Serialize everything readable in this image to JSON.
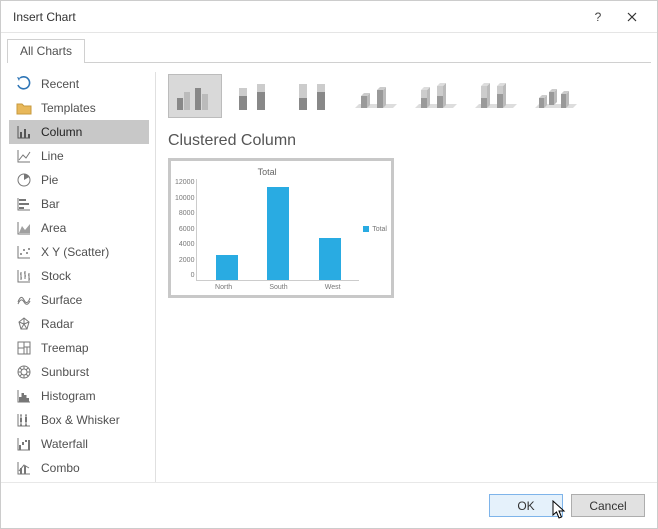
{
  "window": {
    "title": "Insert Chart",
    "help": "?",
    "close": "✕"
  },
  "tabs": {
    "all_charts": "All Charts"
  },
  "side_items": [
    {
      "icon": "recent-icon",
      "label": "Recent"
    },
    {
      "icon": "templates-icon",
      "label": "Templates"
    },
    {
      "icon": "column-icon",
      "label": "Column",
      "selected": true
    },
    {
      "icon": "line-icon",
      "label": "Line"
    },
    {
      "icon": "pie-icon",
      "label": "Pie"
    },
    {
      "icon": "bar-icon",
      "label": "Bar"
    },
    {
      "icon": "area-icon",
      "label": "Area"
    },
    {
      "icon": "xy-icon",
      "label": "X Y (Scatter)"
    },
    {
      "icon": "stock-icon",
      "label": "Stock"
    },
    {
      "icon": "surface-icon",
      "label": "Surface"
    },
    {
      "icon": "radar-icon",
      "label": "Radar"
    },
    {
      "icon": "treemap-icon",
      "label": "Treemap"
    },
    {
      "icon": "sunburst-icon",
      "label": "Sunburst"
    },
    {
      "icon": "histogram-icon",
      "label": "Histogram"
    },
    {
      "icon": "boxwhisker-icon",
      "label": "Box & Whisker"
    },
    {
      "icon": "waterfall-icon",
      "label": "Waterfall"
    },
    {
      "icon": "combo-icon",
      "label": "Combo"
    }
  ],
  "subtype_title": "Clustered Column",
  "subtypes": [
    {
      "name": "clustered-column",
      "selected": true
    },
    {
      "name": "stacked-column",
      "selected": false
    },
    {
      "name": "100-stacked-column",
      "selected": false
    },
    {
      "name": "3d-clustered-column",
      "selected": false
    },
    {
      "name": "3d-stacked-column",
      "selected": false
    },
    {
      "name": "3d-100-stacked-column",
      "selected": false
    },
    {
      "name": "3d-column",
      "selected": false
    }
  ],
  "footer": {
    "ok": "OK",
    "cancel": "Cancel"
  },
  "chart_data": {
    "type": "bar",
    "title": "Total",
    "categories": [
      "North",
      "South",
      "West"
    ],
    "series": [
      {
        "name": "Total",
        "values": [
          3000,
          11000,
          5000
        ]
      }
    ],
    "ylabel": "",
    "xlabel": "",
    "ylim": [
      0,
      12000
    ],
    "yticks": [
      0,
      2000,
      4000,
      6000,
      8000,
      10000,
      12000
    ],
    "legend": [
      "Total"
    ]
  }
}
